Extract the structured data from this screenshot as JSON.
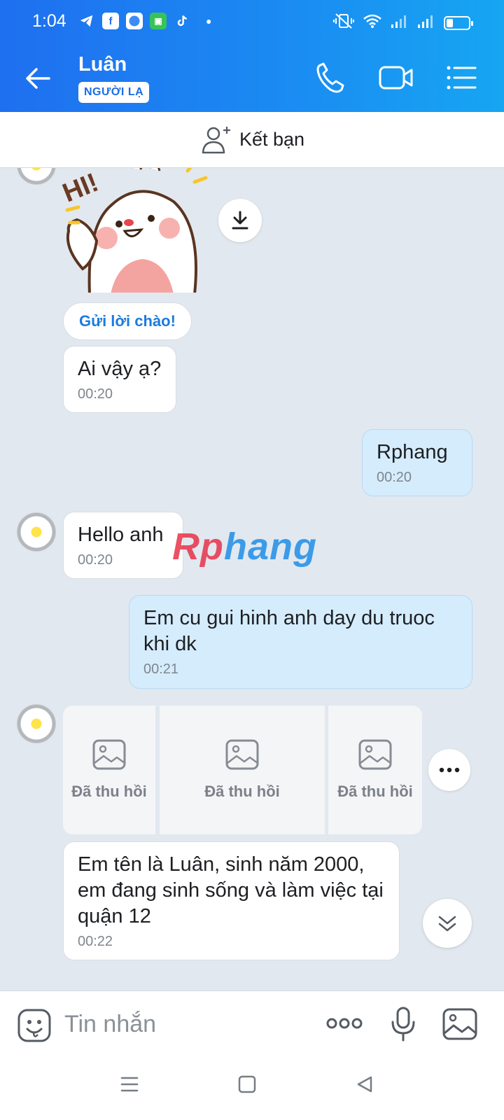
{
  "status": {
    "time": "1:04",
    "app_icons": [
      "telegram-icon",
      "facebook-icon",
      "messenger-icon",
      "wechat-icon",
      "tiktok-icon"
    ],
    "right_icons": [
      "vibrate-icon",
      "wifi-icon",
      "signal-icon",
      "signal-icon",
      "battery-icon"
    ]
  },
  "header": {
    "title": "Luân",
    "badge": "NGƯỜI LẠ"
  },
  "friend_bar": {
    "label": "Kết bạn"
  },
  "chat": {
    "greeting_button": "Gửi lời chào!",
    "messages": [
      {
        "text": "Ai vậy ạ?",
        "time": "00:20",
        "from": "them"
      },
      {
        "text": "Rphang",
        "time": "00:20",
        "from": "me"
      },
      {
        "text": "Hello anh",
        "time": "00:20",
        "from": "them"
      },
      {
        "text": "Em cu gui hinh anh day du truoc khi dk",
        "time": "00:21",
        "from": "me"
      },
      {
        "text": "Em tên là Luân, sinh năm 2000, em đang sinh sống và làm việc tại quận 12",
        "time": "00:22",
        "from": "them"
      }
    ],
    "recalled_images": [
      "Đã thu hồi",
      "Đã thu hồi",
      "Đã thu hồi"
    ],
    "watermark": "Rphang"
  },
  "input": {
    "placeholder": "Tin nhắn"
  },
  "colors": {
    "header_start": "#1f6ff0",
    "header_end": "#16a6f2",
    "chat_bg": "#e2e8ef",
    "my_bubble": "#d5ecfd",
    "accent": "#1b7be0"
  }
}
